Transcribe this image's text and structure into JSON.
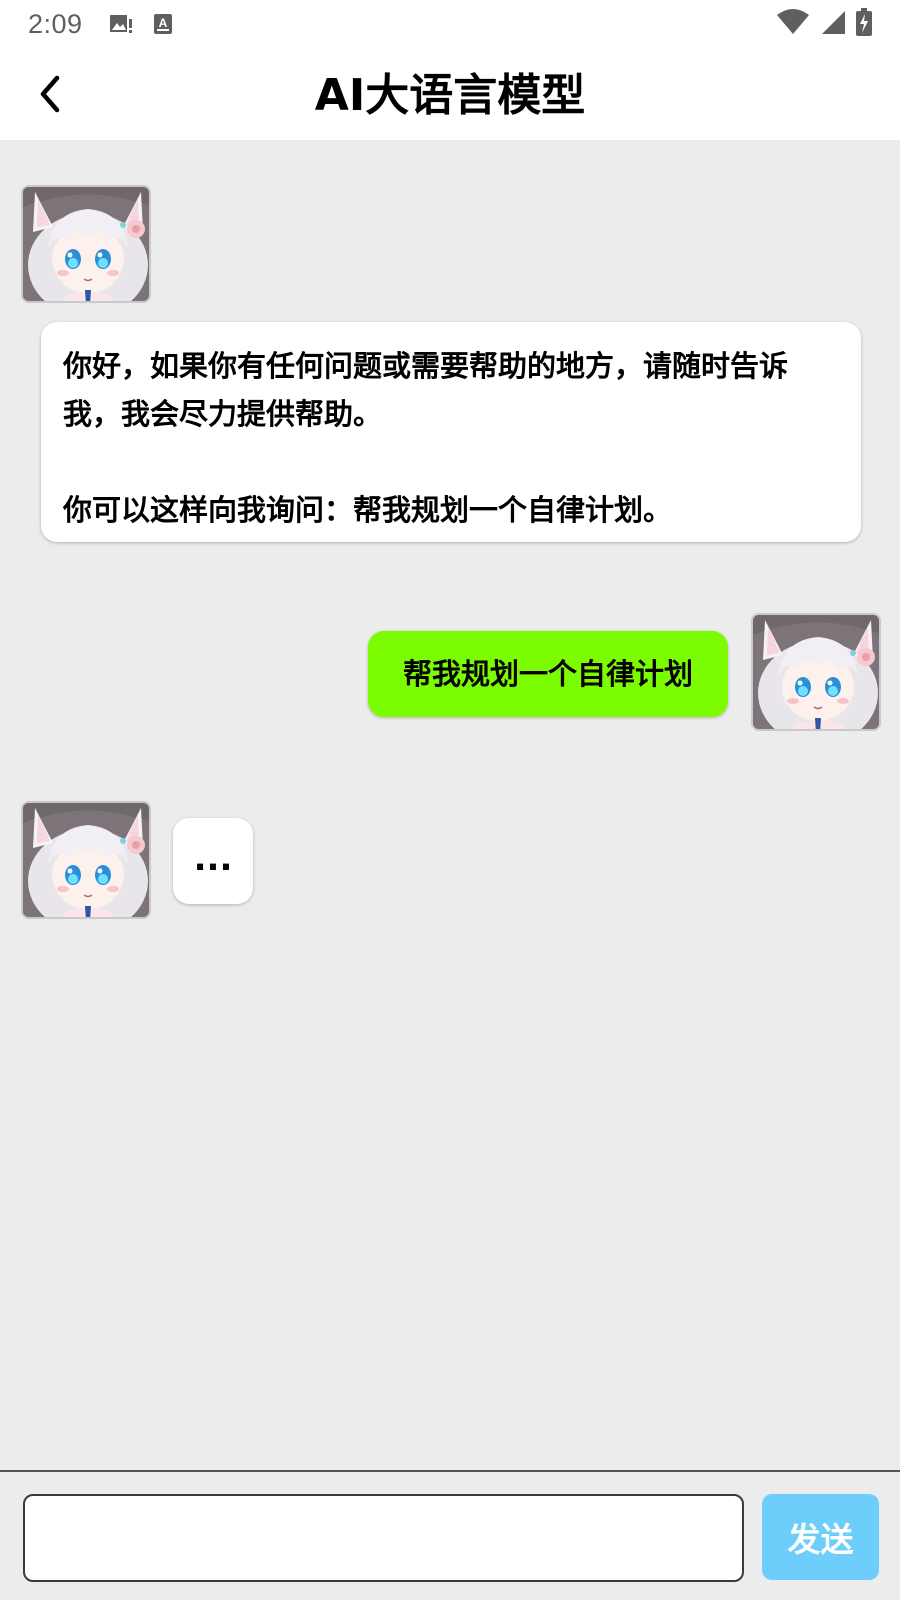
{
  "status_bar": {
    "time": "2:09",
    "icons": [
      "image-notification-icon",
      "text-notification-icon",
      "wifi-icon",
      "signal-icon",
      "battery-charging-icon"
    ]
  },
  "header": {
    "title": "AI大语言模型",
    "back_icon": "chevron-left-icon"
  },
  "messages": [
    {
      "sender": "assistant",
      "text": "你好，如果你有任何问题或需要帮助的地方，请随时告诉我，我会尽力提供帮助。\n\n你可以这样向我询问：帮我规划一个自律计划。",
      "avatar": "anime-cat-girl-avatar"
    },
    {
      "sender": "user",
      "text": "帮我规划一个自律计划",
      "avatar": "anime-cat-girl-avatar"
    },
    {
      "sender": "assistant",
      "text": "...",
      "avatar": "anime-cat-girl-avatar"
    }
  ],
  "composer": {
    "input_value": "",
    "send_label": "发送"
  },
  "colors": {
    "user_bubble": "#7cfc00",
    "assistant_bubble": "#ffffff",
    "send_button": "#6dcefb",
    "background": "#ececec"
  }
}
